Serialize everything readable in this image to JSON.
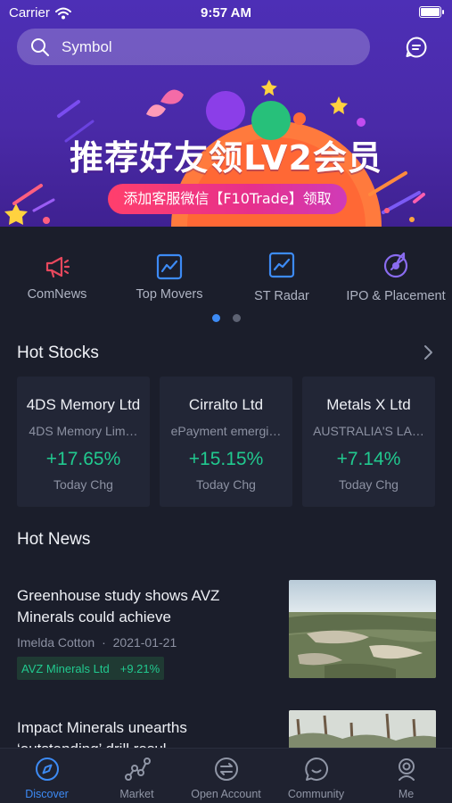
{
  "status_bar": {
    "carrier": "Carrier",
    "time": "9:57 AM"
  },
  "search": {
    "placeholder": "Symbol"
  },
  "banner": {
    "title": "推荐好友领LV2会员",
    "subtitle": "添加客服微信【F10Trade】领取"
  },
  "quick_menu": {
    "items": [
      {
        "label": "ComNews",
        "icon": "megaphone-icon",
        "color": "#e8485d"
      },
      {
        "label": "Top Movers",
        "icon": "line-chart-icon",
        "color": "#3d8bf5"
      },
      {
        "label": "ST Radar",
        "icon": "radar-chart-icon",
        "color": "#3d8bf5"
      },
      {
        "label": "IPO & Placement",
        "icon": "rocket-icon",
        "color": "#8a6cf0"
      }
    ],
    "page_count": 2,
    "active_page": 1
  },
  "hot_stocks": {
    "title": "Hot Stocks",
    "cards": [
      {
        "name": "4DS Memory Ltd",
        "desc": "4DS Memory Lim…",
        "change": "+17.65%",
        "label": "Today Chg"
      },
      {
        "name": "Cirralto Ltd",
        "desc": "ePayment emergi…",
        "change": "+15.15%",
        "label": "Today Chg"
      },
      {
        "name": "Metals X Ltd",
        "desc": "AUSTRALIA'S LA…",
        "change": "+7.14%",
        "label": "Today Chg"
      }
    ]
  },
  "hot_news": {
    "title": "Hot News",
    "items": [
      {
        "headline": "Greenhouse study shows AVZ Minerals could achieve",
        "author": "Imelda Cotton",
        "date": "2021-01-21",
        "tag_name": "AVZ Minerals Ltd",
        "tag_change": "+9.21%"
      },
      {
        "headline": "Impact Minerals unearths ‘outstanding’ drill resul…"
      }
    ]
  },
  "tab_bar": {
    "tabs": [
      {
        "label": "Discover",
        "icon": "compass-icon",
        "active": true
      },
      {
        "label": "Market",
        "icon": "market-chart-icon",
        "active": false
      },
      {
        "label": "Open Account",
        "icon": "exchange-icon",
        "active": false
      },
      {
        "label": "Community",
        "icon": "chat-bubble-icon",
        "active": false
      },
      {
        "label": "Me",
        "icon": "user-icon",
        "active": false
      }
    ]
  },
  "colors": {
    "accent": "#3d8bf5",
    "positive": "#21c98f",
    "background": "#1b1e2b",
    "banner": "#4d2fb6"
  }
}
